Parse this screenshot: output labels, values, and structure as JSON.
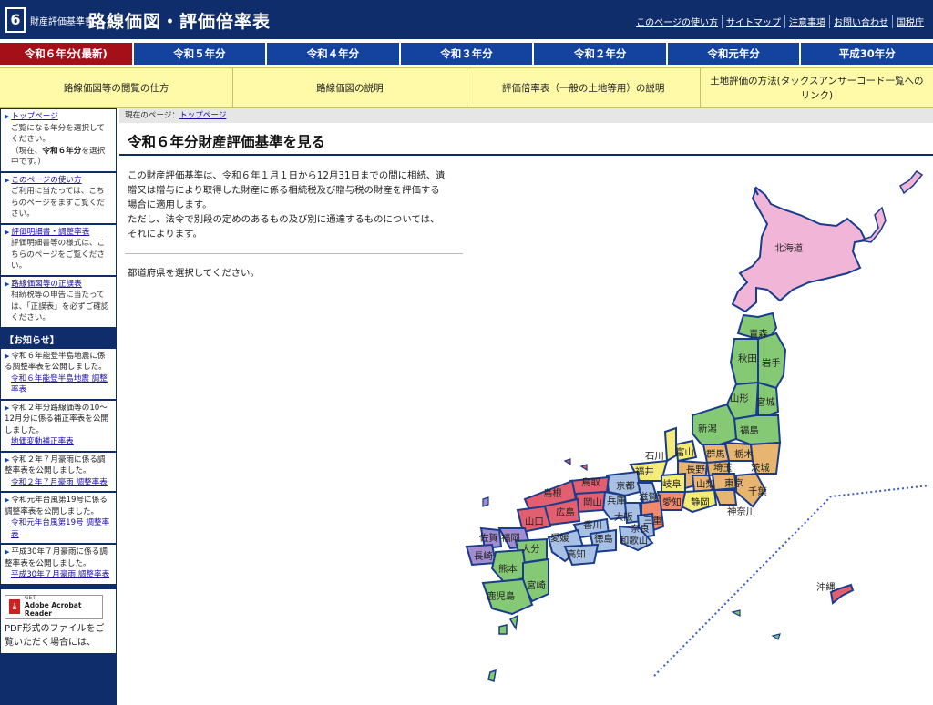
{
  "header": {
    "logo_number": "6",
    "subtitle": "財産評価基準書",
    "title": "路線価図・評価倍率表",
    "links": [
      "このページの使い方",
      "サイトマップ",
      "注意事項",
      "お問い合わせ",
      "国税庁"
    ]
  },
  "year_tabs": [
    {
      "label": "令和６年分(最新)"
    },
    {
      "label": "令和５年分"
    },
    {
      "label": "令和４年分"
    },
    {
      "label": "令和３年分"
    },
    {
      "label": "令和２年分"
    },
    {
      "label": "令和元年分"
    },
    {
      "label": "平成30年分"
    }
  ],
  "guide_nav": [
    {
      "label": "路線価図等の閲覧の仕方"
    },
    {
      "label": "路線価図の説明"
    },
    {
      "label": "評価倍率表（一般の土地等用）の説明"
    },
    {
      "label": "土地評価の方法(タックスアンサーコード一覧へのリンク)"
    }
  ],
  "sidebar": {
    "items": [
      {
        "link": "トップページ",
        "desc": "ご覧になる年分を選択してください。",
        "desc2": "（現在、",
        "desc_strong": "令和６年分",
        "desc3": "を選択中です。）"
      },
      {
        "link": "このページの使い方",
        "desc": "ご利用に当たっては、こちらのページをまずご覧ください。"
      },
      {
        "link": "評価明細書・調整率表",
        "desc": "評価明細書等の様式は、こちらのページをご覧ください。"
      },
      {
        "link": "路線価図等の正誤表",
        "desc": "相続税等の申告に当たっては、「正誤表」を必ずご確認ください。"
      }
    ],
    "news_heading": "【お知らせ】",
    "news": [
      {
        "text": "令和６年能登半島地震に係る調整率表を公開しました。",
        "link": "令和６年能登半島地震 調整率表"
      },
      {
        "text": "令和２年分路線価等の10～12月分に係る補正率表を公開しました。",
        "link": "地価変動補正率表"
      },
      {
        "text": "令和２年７月豪雨に係る調整率表を公開しました。",
        "link": "令和２年７月豪雨 調整率表"
      },
      {
        "text": "令和元年台風第19号に係る調整率表を公開しました。",
        "link": "令和元年台風第19号 調整率表"
      },
      {
        "text": "平成30年７月豪雨に係る調整率表を公開しました。",
        "link": "平成30年７月豪雨 調整率表"
      }
    ],
    "adobe": {
      "get": "GET",
      "name": "Adobe Acrobat Reader",
      "caption": "PDF形式のファイルをご覧いただく場合には、"
    }
  },
  "main": {
    "breadcrumb_prefix": "現在のページ：",
    "breadcrumb_link": "トップページ",
    "heading": "令和６年分財産評価基準を見る",
    "intro_lines": [
      "この財産評価基準は、令和６年１月１日から12月31日までの間に相続、遺",
      "贈又は贈与により取得した財産に係る相続税及び贈与税の財産を評価する",
      "場合に適用します。",
      "ただし、法令で別段の定めのあるもの及び別に通達するものについては、",
      "それによります。"
    ],
    "select_message": "都道府県を選択してください。"
  },
  "map": {
    "prefectures": {
      "hokkaido": "北海道",
      "aomori": "青森",
      "akita": "秋田",
      "iwate": "岩手",
      "yamagata": "山形",
      "miyagi": "宮城",
      "niigata": "新潟",
      "fukushima": "福島",
      "ishikawa": "石川",
      "toyama": "富山",
      "gunma": "群馬",
      "tochigi": "栃木",
      "ibaraki": "茨城",
      "fukui": "福井",
      "nagano": "長野",
      "saitama": "埼玉",
      "gifu": "岐阜",
      "yamanashi": "山梨",
      "tokyo": "東京",
      "chiba": "千葉",
      "kanagawa": "神奈川",
      "shizuoka": "静岡",
      "aichi": "愛知",
      "mie": "三重",
      "shiga": "滋賀",
      "kyoto": "京都",
      "hyogo": "兵庫",
      "osaka": "大阪",
      "nara": "奈良",
      "wakayama": "和歌山",
      "tottori": "鳥取",
      "shimane": "島根",
      "okayama": "岡山",
      "hiroshima": "広島",
      "yamaguchi": "山口",
      "kagawa": "香川",
      "tokushima": "徳島",
      "ehime": "愛媛",
      "kochi": "高知",
      "fukuoka": "福岡",
      "saga": "佐賀",
      "nagasaki": "長崎",
      "oita": "大分",
      "kumamoto": "熊本",
      "miyazaki": "宮崎",
      "kagoshima": "鹿児島",
      "okinawa": "沖縄"
    }
  }
}
